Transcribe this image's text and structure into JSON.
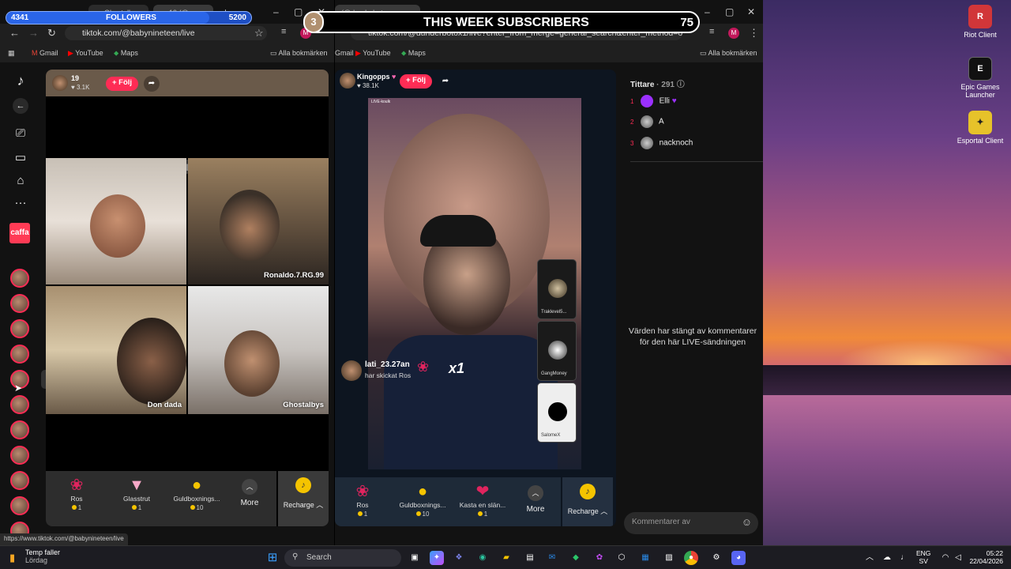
{
  "overlays": {
    "followers": {
      "current": "4341",
      "label": "FOLLOWERS",
      "goal": "5200",
      "progress": 0.83
    },
    "subscribers": {
      "badge": "3",
      "label": "THIS WEEK SUBSCRIBERS",
      "count": "75"
    }
  },
  "left_window": {
    "tabs": [
      "Ghostalb",
      "19 (@"
    ],
    "url": "tiktok.com/@babynineteen/live",
    "bookmarks": [
      "Gmail",
      "YouTube",
      "Maps",
      "Alla bokmärken"
    ],
    "status_url": "https://www.tiktok.com/@babynineteen/live",
    "sidebar": {
      "caffa_label": "caffa",
      "badge": "19"
    },
    "live": {
      "host_name": "19",
      "host_likes": "3.1K",
      "follow_label": "+ Följ",
      "participants": [
        "Ronaldo.7.RG.99",
        "Don dada",
        "Ghostalbys"
      ]
    },
    "gifts": [
      {
        "name": "Ros",
        "price": "1"
      },
      {
        "name": "Glasstrut",
        "price": "1"
      },
      {
        "name": "Guldboxnings...",
        "price": "10"
      }
    ],
    "more_label": "More",
    "recharge_label": "Recharge"
  },
  "right_window": {
    "tab": "(@dunderboto...",
    "url": "tiktok.com/@dunderbotox1/live?enter_from_merge=general_search&enter_method=others_...",
    "bookmarks": [
      "Gmail",
      "YouTube",
      "Maps",
      "Alla bokmärken"
    ],
    "live": {
      "host_name": "Kingopps",
      "host_likes": "38.1K",
      "follow_label": "+ Följ",
      "live_tag": "LIVE-koulk",
      "guests": [
        "Traklevel5...",
        "GangMoney",
        "SalomeX"
      ],
      "gift_sender": "lati_23.27an",
      "gift_action": "har skickat Ros",
      "gift_count": "x1"
    },
    "gifts": [
      {
        "name": "Ros",
        "price": "1"
      },
      {
        "name": "Guldboxnings...",
        "price": "10"
      },
      {
        "name": "Kasta en slän...",
        "price": "1"
      }
    ],
    "more_label": "More",
    "recharge_label": "Recharge",
    "viewers": {
      "title": "Tittare",
      "count": "291",
      "list": [
        {
          "rank": "1",
          "name": "Elli"
        },
        {
          "rank": "2",
          "name": "A"
        },
        {
          "rank": "3",
          "name": "nacknoch"
        }
      ],
      "comments_closed": "Värden har stängt av kommentarer för den här LIVE-sändningen",
      "comment_placeholder": "Kommentarer av"
    }
  },
  "desktop_icons": [
    {
      "label": "Riot Client"
    },
    {
      "label": "Epic Games Launcher"
    },
    {
      "label": "Esportal Client"
    }
  ],
  "taskbar": {
    "weather_title": "Temp faller",
    "weather_sub": "Lördag",
    "search_label": "Search",
    "lang": "ENG",
    "lang_sub": "SV",
    "time": "05:22",
    "date": "22/04/2026"
  }
}
